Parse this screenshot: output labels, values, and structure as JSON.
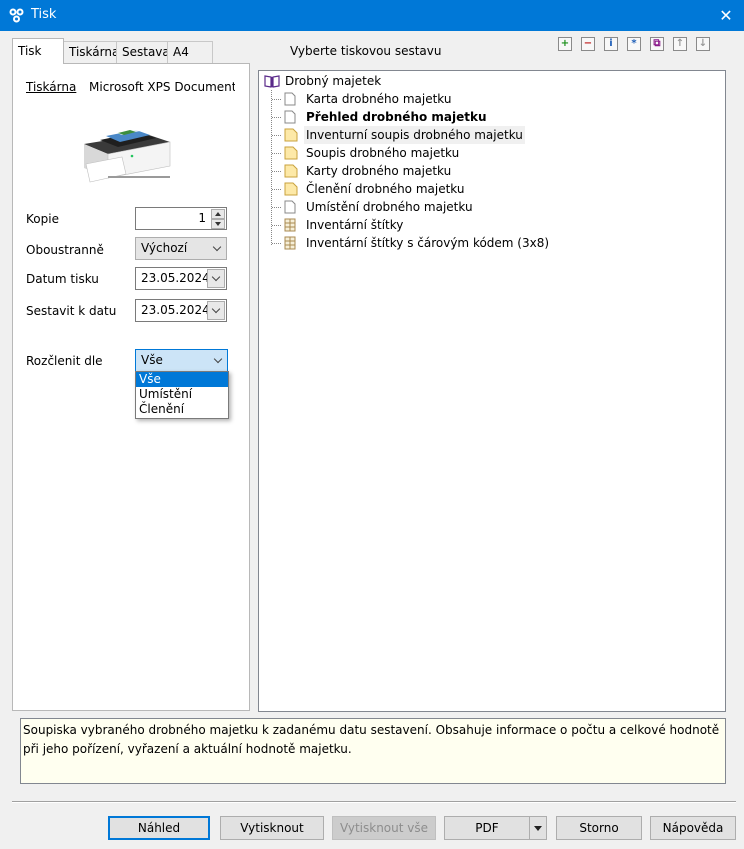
{
  "window": {
    "title": "Tisk",
    "close_label": "✕"
  },
  "tabs": [
    {
      "label": "Tisk"
    },
    {
      "label": "Tiskárna"
    },
    {
      "label": "Sestava"
    },
    {
      "label": "A4"
    }
  ],
  "form": {
    "printer_label": "Tiskárna",
    "printer_value": "Microsoft XPS Document W",
    "copies_label": "Kopie",
    "copies_value": "1",
    "duplex_label": "Oboustranně",
    "duplex_value": "Výchozí",
    "print_date_label": "Datum tisku",
    "print_date_value": "23.05.2024",
    "report_date_label": "Sestavit k datu",
    "report_date_value": "23.05.2024",
    "split_label": "Rozčlenit dle",
    "split_value": "Vše",
    "split_options": [
      "Vše",
      "Umístění",
      "Členění"
    ]
  },
  "report": {
    "section_title": "Vyberte tiskovou sestavu",
    "toolbar_icons": [
      "add-icon",
      "remove-icon",
      "info-icon",
      "star-icon",
      "copy-icon",
      "move-up-icon",
      "move-down-icon"
    ],
    "root": "Drobný majetek",
    "items": [
      {
        "label": "Karta drobného majetku",
        "icon": "page-icon"
      },
      {
        "label": "Přehled drobného majetku",
        "icon": "page-icon"
      },
      {
        "label": "Inventurní soupis drobného majetku",
        "icon": "folder-page-icon"
      },
      {
        "label": "Soupis drobného majetku",
        "icon": "folder-page-icon"
      },
      {
        "label": "Karty drobného majetku",
        "icon": "folder-page-icon"
      },
      {
        "label": "Členění drobného majetku",
        "icon": "folder-page-icon"
      },
      {
        "label": "Umístění drobného majetku",
        "icon": "page-icon"
      },
      {
        "label": "Inventární štítky",
        "icon": "grid-page-icon"
      },
      {
        "label": "Inventární štítky s čárovým kódem (3x8)",
        "icon": "grid-page-icon"
      }
    ],
    "description": "Soupiska vybraného drobného majetku k zadanému datu sestavení. Obsahuje informace o počtu a celkové hodnotě při jeho pořízení, vyřazení a aktuální hodnotě majetku."
  },
  "buttons": {
    "preview": "Náhled",
    "print": "Vytisknout",
    "print_all": "Vytisknout vše",
    "pdf": "PDF",
    "cancel": "Storno",
    "help": "Nápověda"
  },
  "colors": {
    "accent": "#0078d7",
    "description_bg": "#fffff0"
  }
}
